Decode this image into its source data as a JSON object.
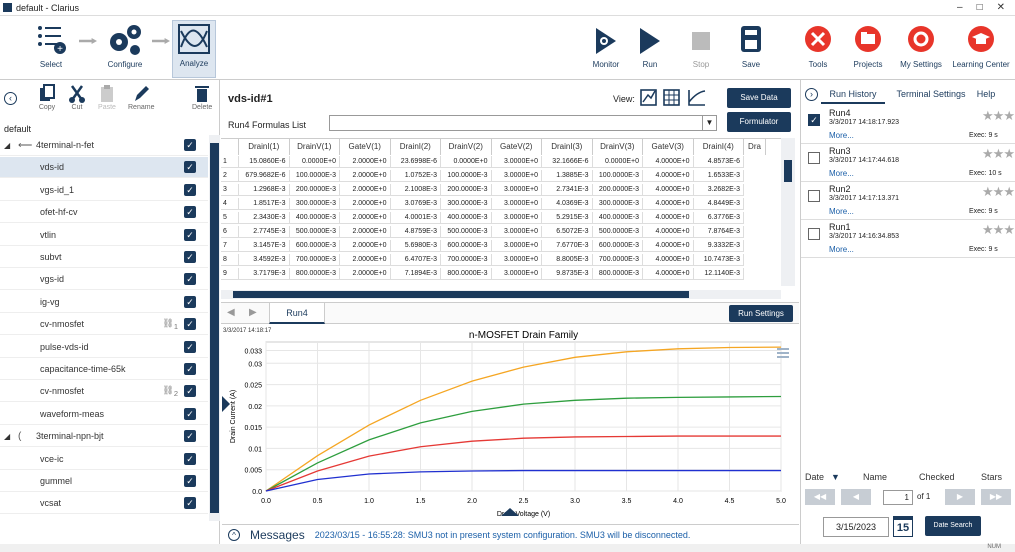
{
  "window": {
    "title": "default - Clarius",
    "min": "–",
    "max": "□",
    "close": "✕"
  },
  "toolbar": {
    "select": "Select",
    "configure": "Configure",
    "analyze": "Analyze",
    "monitor": "Monitor",
    "run": "Run",
    "stop": "Stop",
    "save": "Save",
    "tools": "Tools",
    "projects": "Projects",
    "my_settings": "My Settings",
    "learning_center": "Learning Center"
  },
  "colors": {
    "navy": "#1b3a5c",
    "tools_red": "#e8352a",
    "orange": "#f5a623",
    "green": "#2e9e3e",
    "red": "#e53935",
    "blue": "#2030d0"
  },
  "left": {
    "tools": {
      "copy": "Copy",
      "cut": "Cut",
      "paste": "Paste",
      "rename": "Rename",
      "delete": "Delete"
    },
    "project": "default",
    "tree": [
      {
        "label": "4terminal-n-fet",
        "level": 0,
        "selected": false
      },
      {
        "label": "vds-id",
        "level": 1,
        "selected": true
      },
      {
        "label": "vgs-id_1",
        "level": 1,
        "selected": false
      },
      {
        "label": "ofet-hf-cv",
        "level": 1,
        "selected": false
      },
      {
        "label": "vtlin",
        "level": 1,
        "selected": false
      },
      {
        "label": "subvt",
        "level": 1,
        "selected": false
      },
      {
        "label": "vgs-id",
        "level": 1,
        "selected": false
      },
      {
        "label": "ig-vg",
        "level": 1,
        "selected": false
      },
      {
        "label": "cv-nmosfet",
        "level": 1,
        "selected": false,
        "badge": "1"
      },
      {
        "label": "pulse-vds-id",
        "level": 1,
        "selected": false
      },
      {
        "label": "capacitance-time-65k",
        "level": 1,
        "selected": false
      },
      {
        "label": "cv-nmosfet",
        "level": 1,
        "selected": false,
        "badge": "2"
      },
      {
        "label": "waveform-meas",
        "level": 1,
        "selected": false
      },
      {
        "label": "3terminal-npn-bjt",
        "level": 0,
        "selected": false
      },
      {
        "label": "vce-ic",
        "level": 1,
        "selected": false
      },
      {
        "label": "gummel",
        "level": 1,
        "selected": false
      },
      {
        "label": "vcsat",
        "level": 1,
        "selected": false
      }
    ]
  },
  "center": {
    "title": "vds-id#1",
    "view_label": "View:",
    "save_data": "Save Data",
    "formulas_label": "Run4 Formulas List",
    "formulator": "Formulator",
    "columns": [
      "DrainI(1)",
      "DrainV(1)",
      "GateV(1)",
      "DrainI(2)",
      "DrainV(2)",
      "GateV(2)",
      "DrainI(3)",
      "DrainV(3)",
      "GateV(3)",
      "DrainI(4)",
      "Dra"
    ],
    "rows": [
      [
        "1",
        "15.0860E-6",
        "0.0000E+0",
        "2.0000E+0",
        "23.6998E-6",
        "0.0000E+0",
        "3.0000E+0",
        "32.1666E-6",
        "0.0000E+0",
        "4.0000E+0",
        "4.8573E-6"
      ],
      [
        "2",
        "679.9682E-6",
        "100.0000E-3",
        "2.0000E+0",
        "1.0752E-3",
        "100.0000E-3",
        "3.0000E+0",
        "1.3885E-3",
        "100.0000E-3",
        "4.0000E+0",
        "1.6533E-3"
      ],
      [
        "3",
        "1.2968E-3",
        "200.0000E-3",
        "2.0000E+0",
        "2.1008E-3",
        "200.0000E-3",
        "3.0000E+0",
        "2.7341E-3",
        "200.0000E-3",
        "4.0000E+0",
        "3.2682E-3"
      ],
      [
        "4",
        "1.8517E-3",
        "300.0000E-3",
        "2.0000E+0",
        "3.0769E-3",
        "300.0000E-3",
        "3.0000E+0",
        "4.0369E-3",
        "300.0000E-3",
        "4.0000E+0",
        "4.8449E-3"
      ],
      [
        "5",
        "2.3430E-3",
        "400.0000E-3",
        "2.0000E+0",
        "4.0001E-3",
        "400.0000E-3",
        "3.0000E+0",
        "5.2915E-3",
        "400.0000E-3",
        "4.0000E+0",
        "6.3776E-3"
      ],
      [
        "6",
        "2.7745E-3",
        "500.0000E-3",
        "2.0000E+0",
        "4.8759E-3",
        "500.0000E-3",
        "3.0000E+0",
        "6.5072E-3",
        "500.0000E-3",
        "4.0000E+0",
        "7.8764E-3"
      ],
      [
        "7",
        "3.1457E-3",
        "600.0000E-3",
        "2.0000E+0",
        "5.6980E-3",
        "600.0000E-3",
        "3.0000E+0",
        "7.6770E-3",
        "600.0000E-3",
        "4.0000E+0",
        "9.3332E-3"
      ],
      [
        "8",
        "3.4592E-3",
        "700.0000E-3",
        "2.0000E+0",
        "6.4707E-3",
        "700.0000E-3",
        "3.0000E+0",
        "8.8005E-3",
        "700.0000E-3",
        "4.0000E+0",
        "10.7473E-3"
      ],
      [
        "9",
        "3.7179E-3",
        "800.0000E-3",
        "2.0000E+0",
        "7.1894E-3",
        "800.0000E-3",
        "3.0000E+0",
        "9.8735E-3",
        "800.0000E-3",
        "4.0000E+0",
        "12.1140E-3"
      ]
    ],
    "tab": "Run4",
    "run_settings": "Run Settings",
    "timestamp": "3/3/2017 14:18:17",
    "messages_label": "Messages",
    "message": "2023/03/15 - 16:55:28: SMU3 not in present system configuration. SMU3 will be disconnected."
  },
  "chart_data": {
    "type": "line",
    "title": "n-MOSFET Drain Family",
    "xlabel": "Drain Voltage (V)",
    "ylabel": "Drain Current (A)",
    "xlim": [
      0,
      5
    ],
    "ylim": [
      0,
      0.035
    ],
    "grid": true,
    "xticks": [
      "0.0",
      "0.5",
      "1.0",
      "1.5",
      "2.0",
      "2.5",
      "3.0",
      "3.5",
      "4.0",
      "4.5",
      "5.0"
    ],
    "yticks": [
      "0.0",
      "0.005",
      "0.01",
      "0.015",
      "0.02",
      "0.025",
      "0.03",
      "0.033"
    ],
    "x": [
      0,
      0.5,
      1,
      1.5,
      2,
      2.5,
      3,
      3.5,
      4,
      4.5,
      5
    ],
    "series": [
      {
        "color": "#f5a623",
        "values": [
          0,
          0.0083,
          0.0155,
          0.0213,
          0.0258,
          0.0291,
          0.0314,
          0.0327,
          0.0334,
          0.0337,
          0.0338
        ]
      },
      {
        "color": "#2e9e3e",
        "values": [
          0,
          0.0066,
          0.012,
          0.016,
          0.0187,
          0.0204,
          0.0213,
          0.0218,
          0.022,
          0.0221,
          0.0222
        ]
      },
      {
        "color": "#e53935",
        "values": [
          0,
          0.0047,
          0.0082,
          0.0104,
          0.0117,
          0.0124,
          0.0127,
          0.0128,
          0.0129,
          0.0129,
          0.0129
        ]
      },
      {
        "color": "#2030d0",
        "values": [
          0,
          0.0027,
          0.004,
          0.0045,
          0.0047,
          0.0048,
          0.0048,
          0.0048,
          0.0048,
          0.0048,
          0.0048
        ]
      }
    ]
  },
  "right": {
    "tabs": [
      "Run History",
      "Terminal Settings",
      "Help"
    ],
    "runs": [
      {
        "name": "Run4",
        "date": "3/3/2017 14:18:17.923",
        "more": "More...",
        "exec": "Exec: 9 s",
        "checked": true
      },
      {
        "name": "Run3",
        "date": "3/3/2017 14:17:44.618",
        "more": "More...",
        "exec": "Exec: 10 s",
        "checked": false
      },
      {
        "name": "Run2",
        "date": "3/3/2017 14:17:13.371",
        "more": "More...",
        "exec": "Exec: 9 s",
        "checked": false
      },
      {
        "name": "Run1",
        "date": "3/3/2017 14:16:34.853",
        "more": "More...",
        "exec": "Exec: 9 s",
        "checked": false
      }
    ],
    "sort": {
      "date": "Date",
      "name": "Name",
      "checked": "Checked",
      "stars": "Stars"
    },
    "page": {
      "current": "1",
      "of": "of 1"
    },
    "date_value": "3/15/2023",
    "calendar": "15",
    "date_search": "Date Search"
  },
  "status": {
    "num": "NUM"
  }
}
